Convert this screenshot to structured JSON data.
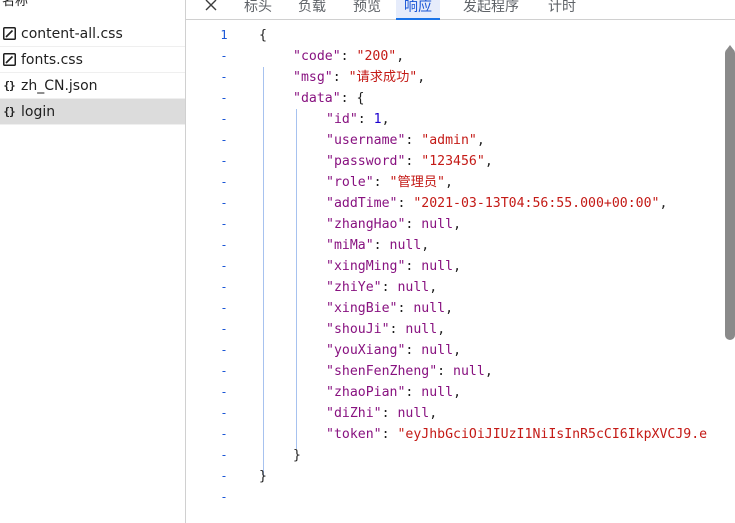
{
  "file_list": {
    "header": "名称",
    "items": [
      {
        "name": "content-all.css",
        "icon": "css-file-icon"
      },
      {
        "name": "fonts.css",
        "icon": "css-file-icon"
      },
      {
        "name": "zh_CN.json",
        "icon": "json-file-icon"
      },
      {
        "name": "login",
        "icon": "json-file-icon"
      }
    ],
    "selected": "login"
  },
  "tabs": {
    "labels": [
      "标头",
      "负载",
      "预览",
      "响应",
      "发起程序",
      "计时"
    ],
    "active": "响应"
  },
  "response": {
    "gutter": [
      "1",
      "-",
      "-",
      "-",
      "-",
      "-",
      "-",
      "-",
      "-",
      "-",
      "-",
      "-",
      "-",
      "-",
      "-",
      "-",
      "-",
      "-",
      "-",
      "-",
      "-",
      "-",
      "-"
    ],
    "lines": {
      "l0": "{",
      "code_key": "\"code\"",
      "code_val": "\"200\"",
      "msg_key": "\"msg\"",
      "msg_val": "\"请求成功\"",
      "data_key": "\"data\"",
      "id_key": "\"id\"",
      "id_val": "1",
      "username_key": "\"username\"",
      "username_val": "\"admin\"",
      "password_key": "\"password\"",
      "password_val": "\"123456\"",
      "role_key": "\"role\"",
      "role_val": "\"管理员\"",
      "addTime_key": "\"addTime\"",
      "addTime_val": "\"2021-03-13T04:56:55.000+00:00\"",
      "zhangHao_key": "\"zhangHao\"",
      "miMa_key": "\"miMa\"",
      "xingMing_key": "\"xingMing\"",
      "zhiYe_key": "\"zhiYe\"",
      "xingBie_key": "\"xingBie\"",
      "shouJi_key": "\"shouJi\"",
      "youXiang_key": "\"youXiang\"",
      "shenFenZheng_key": "\"shenFenZheng\"",
      "zhaoPian_key": "\"zhaoPian\"",
      "diZhi_key": "\"diZhi\"",
      "token_key": "\"token\"",
      "token_val": "\"eyJhbGciOiJIUzI1NiIsInR5cCI6IkpXVCJ9.e",
      "null_val": "null",
      "inner_close": "}",
      "outer_close": "}"
    }
  },
  "colors": {
    "accent": "#1a73e8",
    "key": "#881280",
    "string": "#c41a16",
    "number": "#1c00cf"
  }
}
